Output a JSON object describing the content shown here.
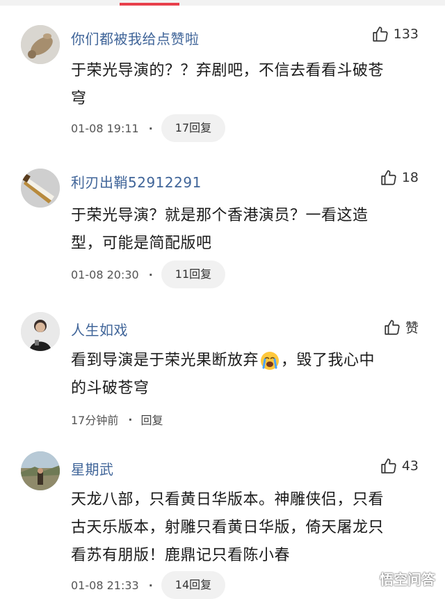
{
  "comments": [
    {
      "username": "你们都被我给点赞啦",
      "likes": "133",
      "text_lines": [
        "于荣光导演的？？弃剧吧，不信去看看斗破苍",
        "穹"
      ],
      "time": "01-08 19:11",
      "reply": "17回复"
    },
    {
      "username": "利刃出鞘52912291",
      "likes": "18",
      "text_lines": [
        "于荣光导演？就是那个香港演员？一看这造",
        "型，可能是简配版吧"
      ],
      "time": "01-08 20:30",
      "reply": "11回复"
    },
    {
      "username": "人生如戏",
      "likes": "赞",
      "text_before_emoji": "看到导演是于荣光果断放弃",
      "text_after_emoji": "，毁了我心中",
      "text_line2": "的斗破苍穹",
      "emoji_icon": "crying-face-emoji",
      "time": "17分钟前",
      "reply": "回复"
    },
    {
      "username": "星期武",
      "likes": "43",
      "text_lines": [
        "天龙八部，只看黄日华版本。神雕侠侣，只看",
        "古天乐版本，射雕只看黄日华版，倚天屠龙只",
        "看苏有朋版！鹿鼎记只看陈小春"
      ],
      "time": "01-08 21:33",
      "reply": "14回复"
    }
  ],
  "watermark": {
    "text": "悟空问答",
    "icon": "wukong-logo-icon"
  },
  "colors": {
    "username": "#406599",
    "accent": "#e8404b",
    "pill": "#f1f1f1"
  }
}
